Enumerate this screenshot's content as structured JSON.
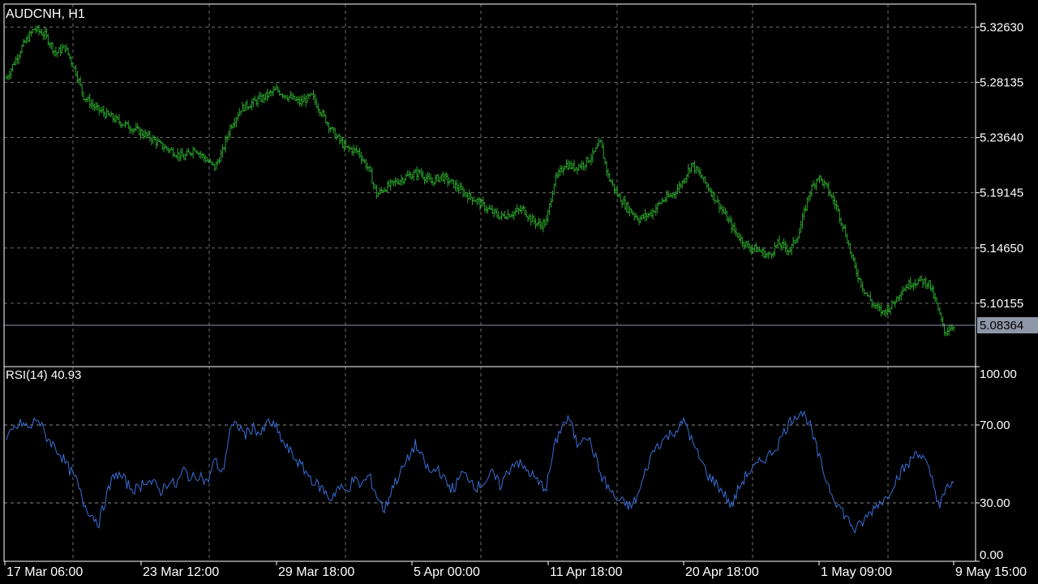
{
  "colors": {
    "background": "#000000",
    "foreground": "#FFFFFF",
    "grid": "#6B6B6B",
    "bars": "#2BA52B",
    "rsi_line": "#3A6FD8",
    "bid_line": "#8A95A8",
    "price_tag_bg": "#8E97A8",
    "price_tag_text": "#000000",
    "level_line": "#8A8A8A"
  },
  "chart_data": [
    {
      "type": "ohlc",
      "symbol_label": "AUDCNH, H1",
      "ylim": [
        5.05,
        5.345
      ],
      "y_ticks": [
        "5.32630",
        "5.28135",
        "5.23640",
        "5.19145",
        "5.14650",
        "5.10155"
      ],
      "current_price": "5.08364",
      "grid": true,
      "x_ticks": [
        "17 Mar 06:00",
        "23 Mar 12:00",
        "29 Mar 18:00",
        "5 Apr 00:00",
        "11 Apr 18:00",
        "20 Apr 18:00",
        "1 May 09:00",
        "9 May 15:00"
      ],
      "price_path": [
        [
          0,
          5.285
        ],
        [
          10,
          5.31
        ],
        [
          18,
          5.325
        ],
        [
          25,
          5.32
        ],
        [
          32,
          5.305
        ],
        [
          38,
          5.31
        ],
        [
          45,
          5.29
        ],
        [
          50,
          5.27
        ],
        [
          58,
          5.26
        ],
        [
          65,
          5.255
        ],
        [
          72,
          5.25
        ],
        [
          80,
          5.245
        ],
        [
          88,
          5.24
        ],
        [
          95,
          5.235
        ],
        [
          100,
          5.23
        ],
        [
          108,
          5.225
        ],
        [
          115,
          5.22
        ],
        [
          122,
          5.228
        ],
        [
          128,
          5.22
        ],
        [
          135,
          5.212
        ],
        [
          140,
          5.225
        ],
        [
          145,
          5.245
        ],
        [
          152,
          5.26
        ],
        [
          160,
          5.265
        ],
        [
          168,
          5.27
        ],
        [
          175,
          5.275
        ],
        [
          182,
          5.27
        ],
        [
          190,
          5.265
        ],
        [
          198,
          5.27
        ],
        [
          205,
          5.255
        ],
        [
          212,
          5.24
        ],
        [
          220,
          5.228
        ],
        [
          228,
          5.225
        ],
        [
          235,
          5.21
        ],
        [
          240,
          5.19
        ],
        [
          245,
          5.195
        ],
        [
          252,
          5.2
        ],
        [
          260,
          5.205
        ],
        [
          268,
          5.208
        ],
        [
          275,
          5.2
        ],
        [
          282,
          5.205
        ],
        [
          290,
          5.198
        ],
        [
          298,
          5.19
        ],
        [
          305,
          5.185
        ],
        [
          312,
          5.178
        ],
        [
          320,
          5.172
        ],
        [
          328,
          5.175
        ],
        [
          335,
          5.178
        ],
        [
          340,
          5.17
        ],
        [
          346,
          5.165
        ],
        [
          350,
          5.168
        ],
        [
          355,
          5.2
        ],
        [
          362,
          5.215
        ],
        [
          368,
          5.212
        ],
        [
          374,
          5.215
        ],
        [
          380,
          5.222
        ],
        [
          385,
          5.232
        ],
        [
          390,
          5.205
        ],
        [
          396,
          5.19
        ],
        [
          402,
          5.18
        ],
        [
          410,
          5.17
        ],
        [
          418,
          5.175
        ],
        [
          425,
          5.185
        ],
        [
          432,
          5.19
        ],
        [
          438,
          5.2
        ],
        [
          444,
          5.215
        ],
        [
          450,
          5.205
        ],
        [
          458,
          5.19
        ],
        [
          465,
          5.175
        ],
        [
          472,
          5.16
        ],
        [
          480,
          5.148
        ],
        [
          487,
          5.145
        ],
        [
          494,
          5.14
        ],
        [
          500,
          5.15
        ],
        [
          508,
          5.145
        ],
        [
          514,
          5.16
        ],
        [
          520,
          5.19
        ],
        [
          526,
          5.205
        ],
        [
          532,
          5.195
        ],
        [
          538,
          5.18
        ],
        [
          544,
          5.158
        ],
        [
          550,
          5.13
        ],
        [
          556,
          5.112
        ],
        [
          562,
          5.1
        ],
        [
          568,
          5.094
        ],
        [
          574,
          5.1
        ],
        [
          580,
          5.112
        ],
        [
          586,
          5.118
        ],
        [
          592,
          5.12
        ],
        [
          598,
          5.118
        ],
        [
          603,
          5.1
        ],
        [
          608,
          5.078
        ],
        [
          614,
          5.084
        ]
      ]
    },
    {
      "type": "line",
      "indicator_label": "RSI(14) 40.93",
      "ylim": [
        0,
        100
      ],
      "y_ticks": [
        "100.00",
        "70.00",
        "30.00",
        "0.00"
      ],
      "levels": [
        70,
        30
      ],
      "rsi_path": [
        [
          0,
          62
        ],
        [
          5,
          68
        ],
        [
          10,
          71
        ],
        [
          15,
          68
        ],
        [
          20,
          74
        ],
        [
          25,
          65
        ],
        [
          30,
          60
        ],
        [
          35,
          55
        ],
        [
          40,
          48
        ],
        [
          45,
          42
        ],
        [
          50,
          30
        ],
        [
          55,
          24
        ],
        [
          60,
          20
        ],
        [
          65,
          34
        ],
        [
          70,
          45
        ],
        [
          75,
          43
        ],
        [
          80,
          38
        ],
        [
          85,
          37
        ],
        [
          90,
          42
        ],
        [
          95,
          40
        ],
        [
          100,
          36
        ],
        [
          105,
          41
        ],
        [
          110,
          39
        ],
        [
          115,
          47
        ],
        [
          120,
          42
        ],
        [
          125,
          45
        ],
        [
          130,
          40
        ],
        [
          135,
          52
        ],
        [
          140,
          45
        ],
        [
          145,
          68
        ],
        [
          150,
          70
        ],
        [
          155,
          65
        ],
        [
          160,
          69
        ],
        [
          165,
          65
        ],
        [
          170,
          72
        ],
        [
          175,
          68
        ],
        [
          180,
          60
        ],
        [
          185,
          55
        ],
        [
          190,
          50
        ],
        [
          195,
          45
        ],
        [
          200,
          40
        ],
        [
          205,
          37
        ],
        [
          210,
          32
        ],
        [
          215,
          38
        ],
        [
          220,
          36
        ],
        [
          225,
          42
        ],
        [
          230,
          39
        ],
        [
          235,
          44
        ],
        [
          240,
          34
        ],
        [
          245,
          26
        ],
        [
          250,
          38
        ],
        [
          255,
          45
        ],
        [
          260,
          52
        ],
        [
          265,
          60
        ],
        [
          270,
          52
        ],
        [
          275,
          45
        ],
        [
          280,
          48
        ],
        [
          285,
          40
        ],
        [
          290,
          37
        ],
        [
          295,
          45
        ],
        [
          300,
          43
        ],
        [
          305,
          38
        ],
        [
          310,
          41
        ],
        [
          315,
          45
        ],
        [
          320,
          39
        ],
        [
          325,
          46
        ],
        [
          330,
          52
        ],
        [
          335,
          48
        ],
        [
          340,
          45
        ],
        [
          345,
          40
        ],
        [
          350,
          38
        ],
        [
          355,
          58
        ],
        [
          360,
          70
        ],
        [
          365,
          73
        ],
        [
          370,
          60
        ],
        [
          375,
          66
        ],
        [
          380,
          58
        ],
        [
          385,
          45
        ],
        [
          390,
          38
        ],
        [
          395,
          32
        ],
        [
          400,
          30
        ],
        [
          405,
          28
        ],
        [
          410,
          35
        ],
        [
          415,
          48
        ],
        [
          420,
          58
        ],
        [
          425,
          62
        ],
        [
          430,
          65
        ],
        [
          435,
          68
        ],
        [
          440,
          72
        ],
        [
          445,
          60
        ],
        [
          450,
          52
        ],
        [
          455,
          44
        ],
        [
          460,
          40
        ],
        [
          465,
          35
        ],
        [
          470,
          28
        ],
        [
          475,
          38
        ],
        [
          480,
          45
        ],
        [
          485,
          48
        ],
        [
          490,
          52
        ],
        [
          495,
          55
        ],
        [
          500,
          60
        ],
        [
          505,
          68
        ],
        [
          510,
          74
        ],
        [
          515,
          77
        ],
        [
          520,
          72
        ],
        [
          525,
          58
        ],
        [
          530,
          45
        ],
        [
          535,
          35
        ],
        [
          540,
          28
        ],
        [
          545,
          22
        ],
        [
          550,
          16
        ],
        [
          555,
          20
        ],
        [
          560,
          25
        ],
        [
          565,
          30
        ],
        [
          570,
          32
        ],
        [
          575,
          40
        ],
        [
          580,
          46
        ],
        [
          585,
          50
        ],
        [
          590,
          57
        ],
        [
          595,
          52
        ],
        [
          600,
          42
        ],
        [
          605,
          28
        ],
        [
          610,
          38
        ],
        [
          614,
          41
        ]
      ]
    }
  ]
}
